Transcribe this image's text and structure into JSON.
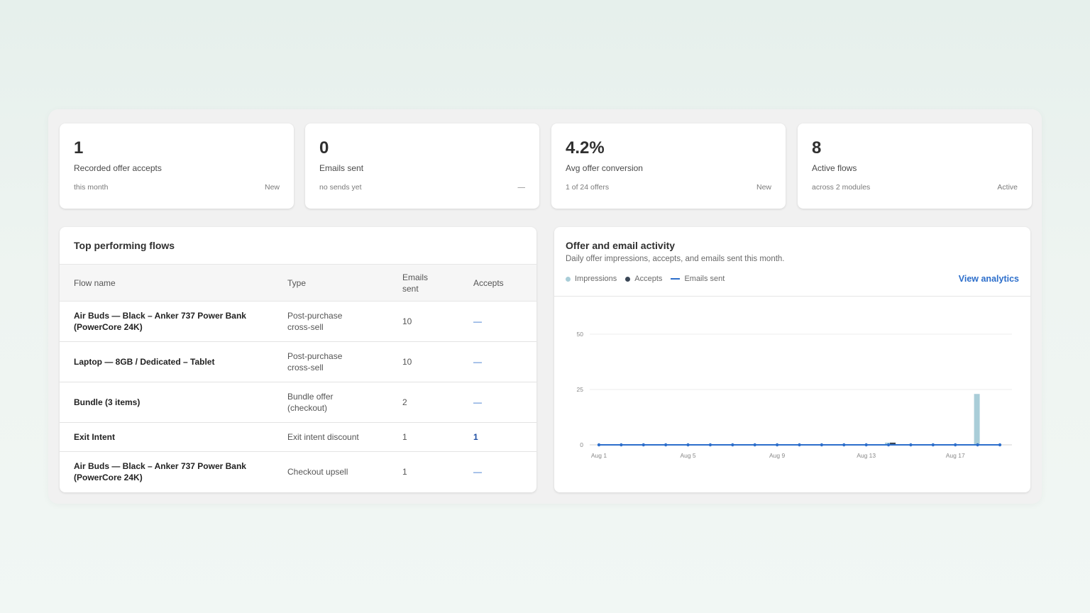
{
  "kpis": [
    {
      "value": "1",
      "label": "Recorded offer accepts",
      "foot_left": "this month",
      "foot_right": "New"
    },
    {
      "value": "0",
      "label": "Emails sent",
      "foot_left": "no sends yet",
      "foot_right": "—"
    },
    {
      "value": "4.2%",
      "label": "Avg offer conversion",
      "foot_left": "1 of 24 offers",
      "foot_right": "New"
    },
    {
      "value": "8",
      "label": "Active flows",
      "foot_left": "across 2 modules",
      "foot_right": "Active"
    }
  ],
  "flows": {
    "title": "Top performing flows",
    "headers": [
      "Flow name",
      "Type",
      "Emails sent",
      "Accepts"
    ],
    "rows": [
      {
        "name": "Air Buds — Black – Anker 737 Power Bank (PowerCore 24K)",
        "type": "Post-purchase cross-sell",
        "emails": "10",
        "accepts": "—"
      },
      {
        "name": "Laptop — 8GB / Dedicated – Tablet",
        "type": "Post-purchase cross-sell",
        "emails": "10",
        "accepts": "—"
      },
      {
        "name": "Bundle (3 items)",
        "type": "Bundle offer (checkout)",
        "emails": "2",
        "accepts": "—"
      },
      {
        "name": "Exit Intent",
        "type": "Exit intent discount",
        "emails": "1",
        "accepts": "1"
      },
      {
        "name": "Air Buds — Black – Anker 737 Power Bank (PowerCore 24K)",
        "type": "Checkout upsell",
        "emails": "1",
        "accepts": "—"
      }
    ]
  },
  "activity": {
    "title": "Offer and email activity",
    "subtitle": "Daily offer impressions, accepts, and emails sent this month.",
    "legend": [
      {
        "label": "Impressions",
        "color": "#a9cdd8",
        "marker": "dot"
      },
      {
        "label": "Accepts",
        "color": "#3a4756",
        "marker": "dot"
      },
      {
        "label": "Emails sent",
        "color": "#2c6ecb",
        "marker": "line"
      }
    ],
    "view_link": "View analytics"
  },
  "chart_data": {
    "type": "bar",
    "title": "Offer and email activity",
    "x": [
      "Aug 1",
      "Aug 2",
      "Aug 3",
      "Aug 4",
      "Aug 5",
      "Aug 6",
      "Aug 7",
      "Aug 8",
      "Aug 9",
      "Aug 10",
      "Aug 11",
      "Aug 12",
      "Aug 13",
      "Aug 14",
      "Aug 15",
      "Aug 16",
      "Aug 17",
      "Aug 18",
      "Aug 19"
    ],
    "x_tick_labels": [
      "Aug 1",
      "Aug 5",
      "Aug 9",
      "Aug 13",
      "Aug 17"
    ],
    "y_ticks": [
      "0",
      "25",
      "50"
    ],
    "ylim": [
      0,
      50
    ],
    "grid": true,
    "legend_position": "top-left",
    "series": [
      {
        "name": "Impressions",
        "type": "bar",
        "color": "#a9cdd8",
        "values": [
          0,
          0,
          0,
          0,
          0,
          0,
          0,
          0,
          0,
          0,
          0,
          0,
          0,
          1,
          0,
          0,
          0,
          23,
          0
        ]
      },
      {
        "name": "Accepts",
        "type": "bar",
        "color": "#3a4756",
        "values": [
          0,
          0,
          0,
          0,
          0,
          0,
          0,
          0,
          0,
          0,
          0,
          0,
          0,
          1,
          0,
          0,
          0,
          0,
          0
        ]
      },
      {
        "name": "Emails sent",
        "type": "line",
        "color": "#2c6ecb",
        "values": [
          0,
          0,
          0,
          0,
          0,
          0,
          0,
          0,
          0,
          0,
          0,
          0,
          0,
          0,
          0,
          0,
          0,
          0,
          0
        ]
      }
    ]
  }
}
